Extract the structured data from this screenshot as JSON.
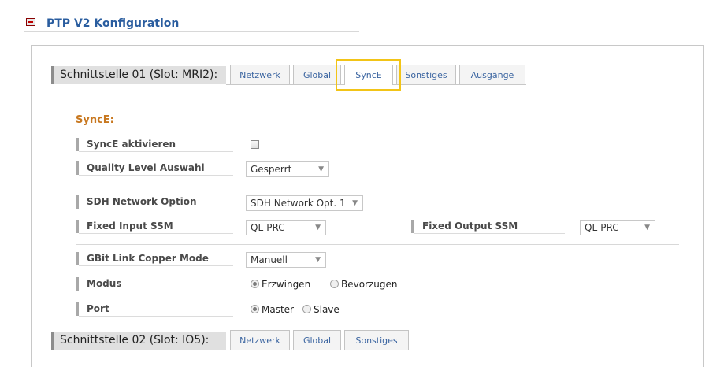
{
  "header": {
    "title": "PTP V2 Konfiguration"
  },
  "interface1": {
    "label": "Schnittstelle 01 (Slot: MRI2):",
    "tabs": [
      "Netzwerk",
      "Global",
      "SyncE",
      "Sonstiges",
      "Ausgänge"
    ],
    "active_tab": "SyncE"
  },
  "synce": {
    "section_title": "SyncE:",
    "activate_label": "SyncE aktivieren",
    "activate_checked": false,
    "quality_label": "Quality Level Auswahl",
    "quality_value": "Gesperrt",
    "sdh_label": "SDH Network Option",
    "sdh_value": "SDH Network Opt. 1",
    "fixed_input_label": "Fixed Input SSM",
    "fixed_input_value": "QL-PRC",
    "fixed_output_label": "Fixed Output SSM",
    "fixed_output_value": "QL-PRC",
    "gbit_label": "GBit Link Copper Mode",
    "gbit_value": "Manuell",
    "modus_label": "Modus",
    "modus_options": [
      "Erzwingen",
      "Bevorzugen"
    ],
    "modus_selected": "Erzwingen",
    "port_label": "Port",
    "port_options": [
      "Master",
      "Slave"
    ],
    "port_selected": "Master"
  },
  "interface2": {
    "label": "Schnittstelle 02 (Slot: IO5):",
    "tabs": [
      "Netzwerk",
      "Global",
      "Sonstiges"
    ]
  },
  "icons": {
    "collapse": "collapse-minus-icon",
    "dropdown": "chevron-down-icon"
  },
  "colors": {
    "accent": "#2a5d9f",
    "section": "#c87820",
    "highlight": "#f2c417"
  }
}
